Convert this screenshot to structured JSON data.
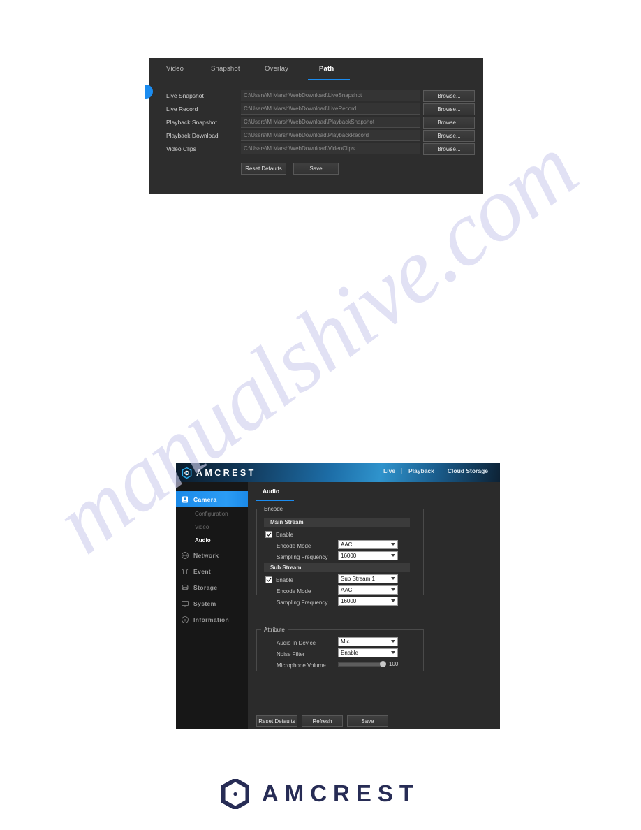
{
  "watermark": {
    "text": "manualshive.com"
  },
  "path_panel": {
    "tabs": [
      {
        "label": "Video",
        "active": false
      },
      {
        "label": "Snapshot",
        "active": false
      },
      {
        "label": "Overlay",
        "active": false
      },
      {
        "label": "Path",
        "active": true
      }
    ],
    "rows": [
      {
        "label": "Live Snapshot",
        "value": "C:\\Users\\M Marsh\\WebDownload\\LiveSnapshot",
        "button": "Browse..."
      },
      {
        "label": "Live Record",
        "value": "C:\\Users\\M Marsh\\WebDownload\\LiveRecord",
        "button": "Browse..."
      },
      {
        "label": "Playback Snapshot",
        "value": "C:\\Users\\M Marsh\\WebDownload\\PlaybackSnapshot",
        "button": "Browse..."
      },
      {
        "label": "Playback Download",
        "value": "C:\\Users\\M Marsh\\WebDownload\\PlaybackRecord",
        "button": "Browse..."
      },
      {
        "label": "Video Clips",
        "value": "C:\\Users\\M Marsh\\WebDownload\\VideoClips",
        "button": "Browse..."
      }
    ],
    "actions": {
      "reset": "Reset Defaults",
      "save": "Save"
    }
  },
  "audio_panel": {
    "header": {
      "brand": "AMCREST",
      "logo_icon": "amcrest-hexagon-icon",
      "nav": [
        {
          "label": "Live"
        },
        {
          "label": "Playback"
        },
        {
          "label": "Cloud Storage"
        }
      ]
    },
    "sidebar": [
      {
        "label": "Camera",
        "icon": "camera-icon",
        "active": true,
        "type": "item"
      },
      {
        "label": "Configuration",
        "icon": "",
        "selected": false,
        "type": "sub"
      },
      {
        "label": "Video",
        "icon": "",
        "selected": false,
        "type": "sub"
      },
      {
        "label": "Audio",
        "icon": "",
        "selected": true,
        "type": "sub"
      },
      {
        "label": "Network",
        "icon": "globe-icon",
        "active": false,
        "type": "item"
      },
      {
        "label": "Event",
        "icon": "alarm-bell-icon",
        "active": false,
        "type": "item"
      },
      {
        "label": "Storage",
        "icon": "storage-disk-icon",
        "active": false,
        "type": "item"
      },
      {
        "label": "System",
        "icon": "monitor-icon",
        "active": false,
        "type": "item"
      },
      {
        "label": "Information",
        "icon": "info-circle-icon",
        "active": false,
        "type": "item"
      }
    ],
    "tab": {
      "label": "Audio"
    },
    "encode": {
      "legend": "Encode",
      "main_stream": {
        "title": "Main Stream",
        "enable_label": "Enable",
        "enable_checked": true,
        "encode_mode_label": "Encode Mode",
        "encode_mode_value": "AAC",
        "sampling_label": "Sampling Frequency",
        "sampling_value": "16000"
      },
      "sub_stream": {
        "title": "Sub Stream",
        "enable_label": "Enable",
        "enable_checked": true,
        "stream_select_value": "Sub Stream 1",
        "encode_mode_label": "Encode Mode",
        "encode_mode_value": "AAC",
        "sampling_label": "Sampling Frequency",
        "sampling_value": "16000"
      }
    },
    "attribute": {
      "legend": "Attribute",
      "audio_in_label": "Audio In Device",
      "audio_in_value": "Mic",
      "noise_filter_label": "Noise Filter",
      "noise_filter_value": "Enable",
      "volume_label": "Microphone Volume",
      "volume_value": "100"
    },
    "actions": {
      "reset": "Reset Defaults",
      "refresh": "Refresh",
      "save": "Save"
    }
  },
  "footer_logo": {
    "brand": "AMCREST",
    "icon": "amcrest-hexagon-icon"
  },
  "colors": {
    "accent_blue": "#1b8cf0",
    "sidebar_active": "#2b9cf5",
    "brand_navy": "#272c55"
  }
}
